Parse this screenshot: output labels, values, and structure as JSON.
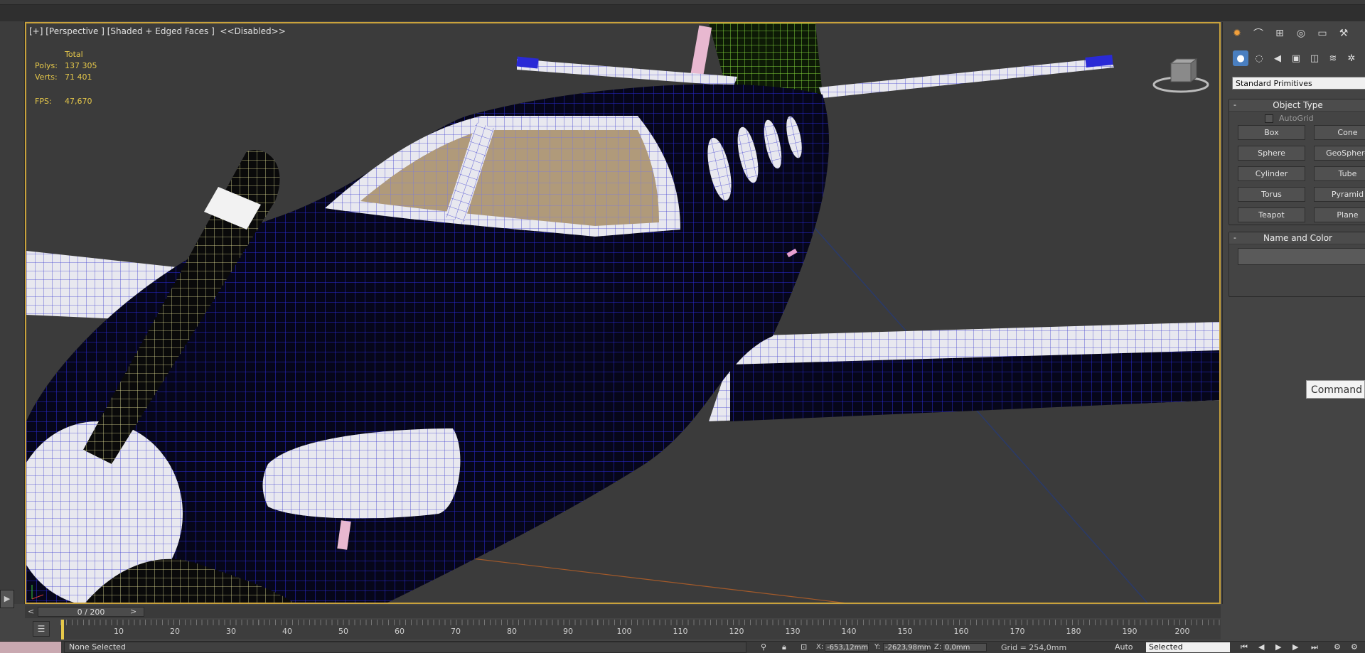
{
  "viewport": {
    "label": "[+] [Perspective ] [Shaded + Edged Faces ]  <<Disabled>>",
    "stats": {
      "total_label": "Total",
      "polys_label": "Polys:",
      "polys_value": "137 305",
      "verts_label": "Verts:",
      "verts_value": "71 401",
      "fps_label": "FPS:",
      "fps_value": "47,670"
    }
  },
  "command_panel": {
    "tabs": [
      {
        "icon": "sun-icon"
      },
      {
        "icon": "modify-curve-icon"
      },
      {
        "icon": "hierarchy-icon"
      },
      {
        "icon": "motion-icon"
      },
      {
        "icon": "display-icon"
      },
      {
        "icon": "utilities-hammer-icon"
      }
    ],
    "create_subtabs": [
      {
        "icon": "geometry-sphere-icon"
      },
      {
        "icon": "shapes-icon"
      },
      {
        "icon": "lights-icon"
      },
      {
        "icon": "cameras-icon"
      },
      {
        "icon": "helpers-icon"
      },
      {
        "icon": "spacewarps-icon"
      },
      {
        "icon": "systems-icon"
      }
    ],
    "dropdown": "Standard Primitives",
    "object_type": {
      "title": "Object Type",
      "collapse": "-",
      "autogrid": "AutoGrid",
      "buttons": [
        "Box",
        "Cone",
        "Sphere",
        "GeoSphere",
        "Cylinder",
        "Tube",
        "Torus",
        "Pyramid",
        "Teapot",
        "Plane"
      ]
    },
    "name_and_color": {
      "title": "Name and Color",
      "collapse": "-"
    },
    "tooltip": "Command"
  },
  "timeline": {
    "frame_display": "0 / 200",
    "prev": "<",
    "next": ">",
    "ticks": [
      "10",
      "20",
      "30",
      "40",
      "50",
      "60",
      "70",
      "80",
      "90",
      "100",
      "110",
      "120",
      "130",
      "140",
      "150",
      "160",
      "170",
      "180",
      "190",
      "200"
    ]
  },
  "status_bar": {
    "message": "None Selected",
    "x_label": "X:",
    "x_value": "-653,12mm",
    "y_label": "Y:",
    "y_value": "-2623,98mm",
    "z_label": "Z:",
    "z_value": "0,0mm",
    "grid": "Grid = 254,0mm",
    "auto": "Auto",
    "selected": "Selected"
  },
  "colors": {
    "viewport_border": "#c9a23c",
    "fuselage_dark": "#0a0a14",
    "wire_blue": "#2a2ad6",
    "stats_yellow": "#e6c84a",
    "wing_white": "#e9e9ef",
    "tail_green": "#7fd23a",
    "prop_yellow": "#e8e69a"
  }
}
